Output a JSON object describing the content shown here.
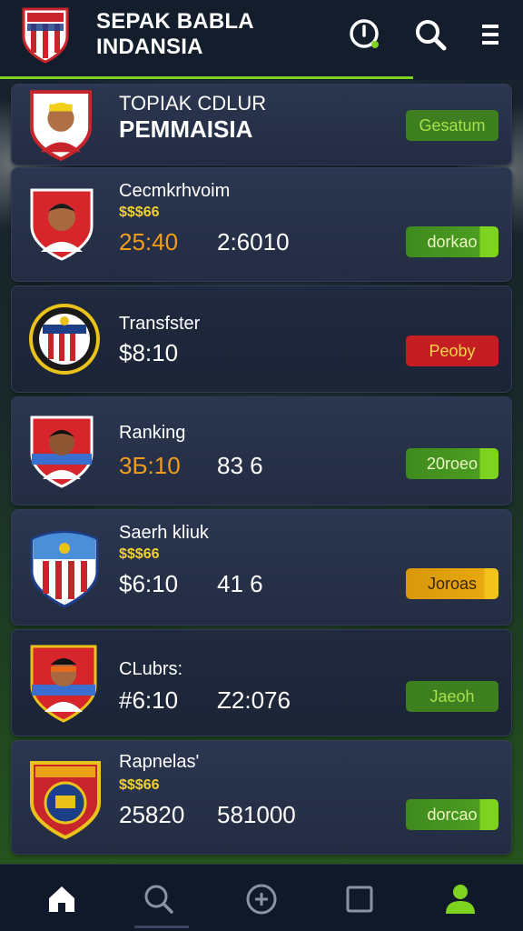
{
  "app": {
    "title_line1": "SEPAK BABLA",
    "title_line2": "INDANSIA"
  },
  "header_icons": [
    "clock-pin-icon",
    "search-icon",
    "menu-icon"
  ],
  "colors": {
    "accent": "#7ed321",
    "header_bg": "#141d2c",
    "card_bg": "#2b3650",
    "value_orange": "#f39c1c",
    "value_yellow": "#f0d030",
    "btn_red": "#c41d22",
    "btn_yellow": "#e8a80f"
  },
  "cards": [
    {
      "title_line1": "TOPIAK CDLUR",
      "title_line2": "PEMMAISIA",
      "button": "Gesatum"
    },
    {
      "title": "Cecmkrhvoim",
      "sub": "$$$66",
      "value1": "25:40",
      "value2": "2:6010",
      "button": "dorkao"
    },
    {
      "title": "Transfster",
      "value1": "$8:10",
      "button": "Peoby"
    },
    {
      "title": "Ranking",
      "value1": "3Б:10",
      "value2": "83 6",
      "button": "20roeo"
    },
    {
      "title": "Saerh kliuk",
      "sub": "$$$66",
      "value1": "$6:10",
      "value2": "41 6",
      "button": "Joroas"
    },
    {
      "title": "CLubrs:",
      "value1": "#6:10",
      "value2": "Z2:076",
      "button": "Jaeoh"
    },
    {
      "title": "Rapnelas'",
      "sub": "$$$66",
      "value1": "25820",
      "value2": "581000",
      "button": "dorcao"
    }
  ],
  "bottom_nav": [
    "home-icon",
    "search-icon",
    "compass-icon",
    "square-icon",
    "profile-icon"
  ]
}
